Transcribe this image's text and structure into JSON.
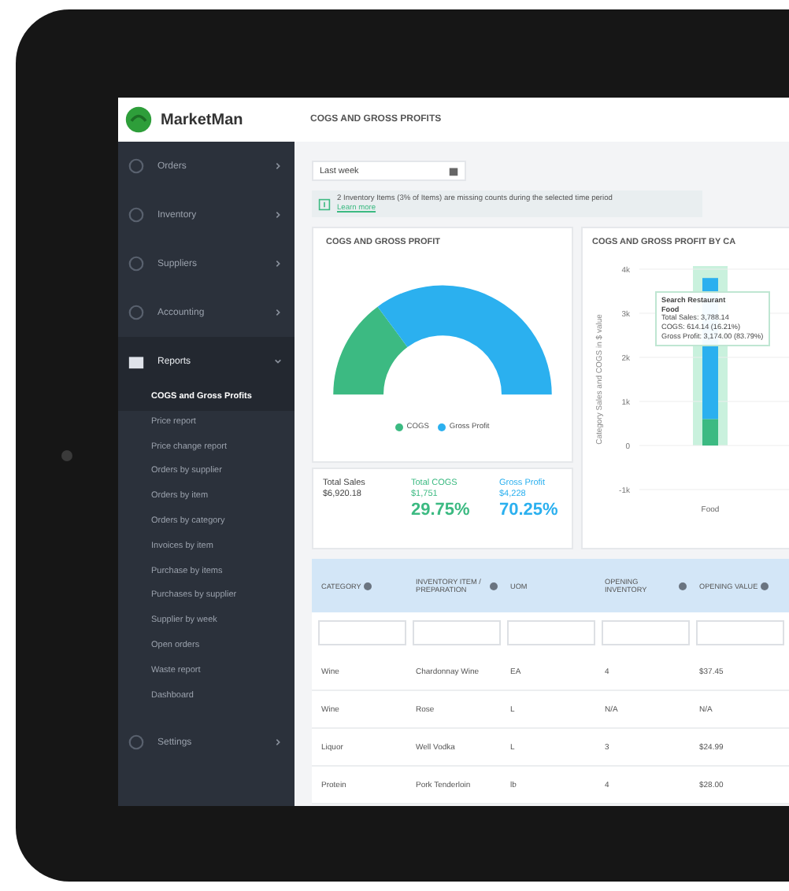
{
  "sidebar": {
    "logo": "MarketMan",
    "items": [
      {
        "label": "Orders",
        "expanded": false
      },
      {
        "label": "Inventory",
        "expanded": false
      },
      {
        "label": "Suppliers",
        "expanded": false
      },
      {
        "label": "Accounting",
        "expanded": false
      },
      {
        "label": "Reports",
        "expanded": true,
        "children": [
          {
            "label": "COGS and Gross Profits",
            "selected": true
          },
          {
            "label": "Price report",
            "selected": false
          },
          {
            "label": "Price change report",
            "selected": false
          },
          {
            "label": "Orders by supplier",
            "selected": false
          },
          {
            "label": "Orders by item",
            "selected": false
          },
          {
            "label": "Orders by category",
            "selected": false
          },
          {
            "label": "Invoices by item",
            "selected": false
          },
          {
            "label": "Purchase by items",
            "selected": false
          },
          {
            "label": "Purchases by supplier",
            "selected": false
          },
          {
            "label": "Supplier by week",
            "selected": false
          },
          {
            "label": "Open orders",
            "selected": false
          },
          {
            "label": "Waste report",
            "selected": false
          },
          {
            "label": "Dashboard",
            "selected": false
          }
        ]
      },
      {
        "label": "Settings",
        "expanded": false
      }
    ]
  },
  "header": {
    "title": "COGS AND GROSS PROFITS"
  },
  "period_select": {
    "value": "Last week"
  },
  "alert": {
    "text": "2 Inventory Items (3% of Items) are missing counts during the selected time period",
    "link": "Learn more"
  },
  "gauge_card": {
    "chart_data": {
      "type": "donut",
      "title": "COGS AND GROSS PROFIT",
      "categories": [
        "COGS",
        "Gross Profit"
      ],
      "values": [
        29.75,
        70.25
      ],
      "colors": [
        "#3cba82",
        "#2bb0ef"
      ]
    }
  },
  "stats": [
    {
      "label": "Total Sales",
      "amount": "$6,920.18",
      "color": "#444444"
    },
    {
      "label": "Total COGS",
      "amount": "$1,751",
      "percent": "29.75%",
      "color": "#3cba82"
    },
    {
      "label": "Gross Profit",
      "amount": "$4,228",
      "percent": "70.25%",
      "color": "#2bb0ef"
    }
  ],
  "bar_card": {
    "chart_data": {
      "type": "bar",
      "title": "COGS AND GROSS PROFIT BY CA",
      "ylabel": "Category Sales and COGS in $ value",
      "categories": [
        "Food"
      ],
      "stacked": true,
      "grid": true,
      "ylim": [
        -1000,
        4000
      ],
      "yticks": [
        {
          "value": 4000,
          "label": "4k"
        },
        {
          "value": 3000,
          "label": "3k"
        },
        {
          "value": 2000,
          "label": "2k"
        },
        {
          "value": 1000,
          "label": "1k"
        },
        {
          "value": 0,
          "label": "0"
        },
        {
          "value": -1000,
          "label": "-1k"
        }
      ],
      "series": [
        {
          "color": "#3cba82",
          "values": [
            600
          ]
        },
        {
          "color": "#2bb0ef",
          "values": [
            3200
          ]
        }
      ]
    },
    "tooltip": [
      "Search Restaurant",
      "Food",
      "Total Sales: 3,788.14",
      "COGS: 614.14 (16.21%)",
      "Gross Profit: 3,174.00 (83.79%)"
    ]
  },
  "table": {
    "columns": [
      {
        "label": "CATEGORY",
        "info": true
      },
      {
        "label": "INVENTORY ITEM / PREPARATION",
        "info": true
      },
      {
        "label": "UOM",
        "info": false
      },
      {
        "label": "OPENING INVENTORY",
        "info": true
      },
      {
        "label": "OPENING VALUE",
        "info": true
      }
    ],
    "rows": [
      [
        "Wine",
        "Chardonnay Wine",
        "EA",
        "4",
        "$37.45"
      ],
      [
        "Wine",
        "Rose",
        "L",
        "N/A",
        "N/A"
      ],
      [
        "Liquor",
        "Well Vodka",
        "L",
        "3",
        "$24.99"
      ],
      [
        "Protein",
        "Pork Tenderloin",
        "lb",
        "4",
        "$28.00"
      ]
    ]
  }
}
